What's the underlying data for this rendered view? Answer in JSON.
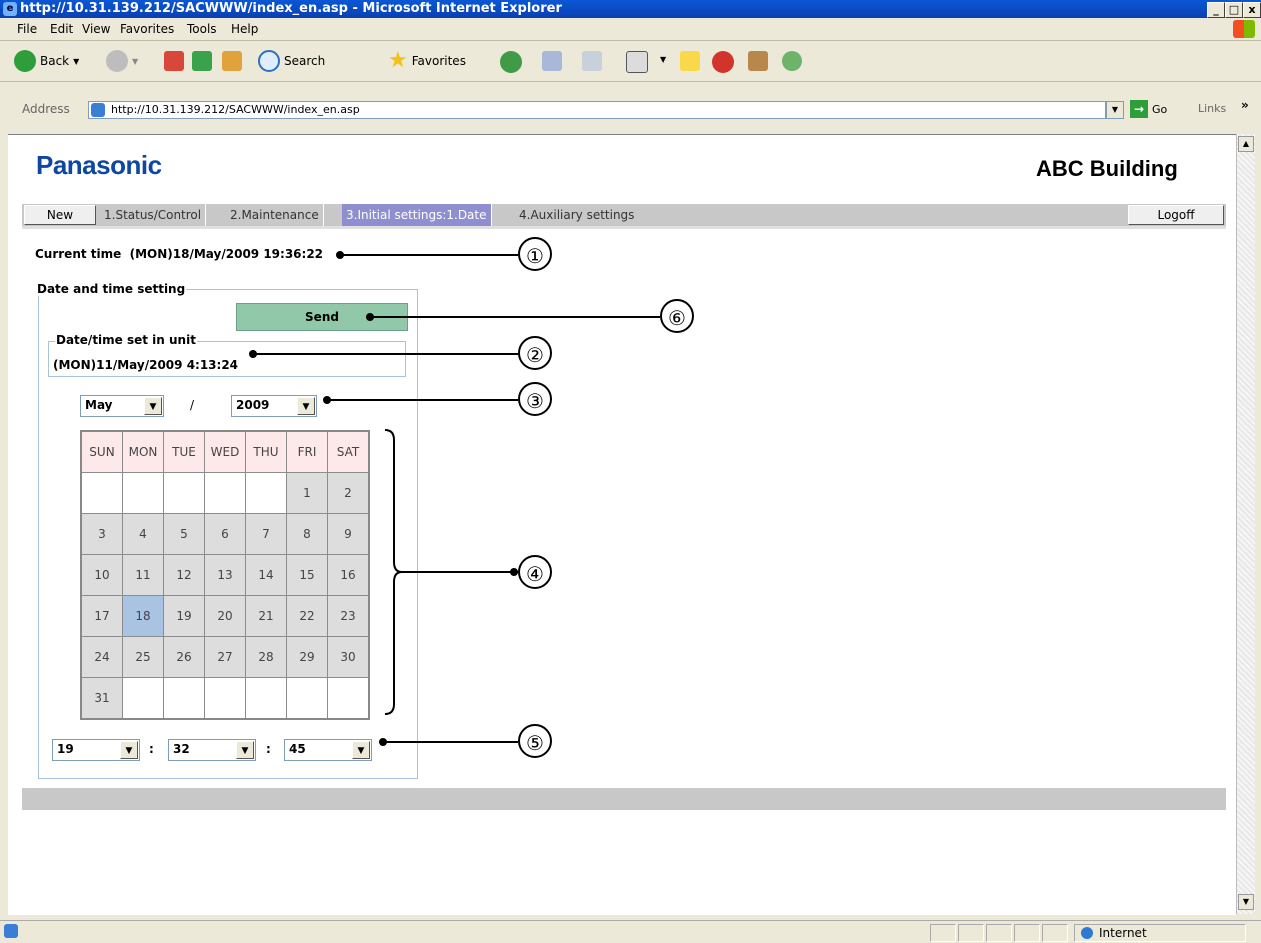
{
  "window": {
    "title": "http://10.31.139.212/SACWWW/index_en.asp - Microsoft Internet Explorer",
    "controls": [
      "_",
      "□",
      "x"
    ]
  },
  "menu": [
    "File",
    "Edit",
    "View",
    "Favorites",
    "Tools",
    "Help"
  ],
  "toolbar": {
    "back": "Back",
    "search": "Search",
    "favorites": "Favorites"
  },
  "address": {
    "label": "Address",
    "url": "http://10.31.139.212/SACWWW/index_en.asp",
    "go": "Go",
    "links": "Links"
  },
  "status": {
    "zone": "Internet"
  },
  "page": {
    "logo": "Panasonic",
    "building": "ABC Building",
    "nav": {
      "new": "New",
      "items": [
        "1.Status/Control",
        "2.Maintenance",
        "3.Initial settings:1.Date",
        "4.Auxiliary settings"
      ],
      "logoff": "Logoff"
    },
    "current_time": "Current time  (MON)18/May/2009 19:36:22",
    "date_setting_legend": "Date and time setting",
    "send_label": "Send",
    "unit_legend": "Date/time set in unit",
    "unit_value": "(MON)11/May/2009 4:13:24",
    "month": "May",
    "sep_slash": "/",
    "year": "2009",
    "calendar": {
      "headers": [
        "SUN",
        "MON",
        "TUE",
        "WED",
        "THU",
        "FRI",
        "SAT"
      ],
      "weeks": [
        [
          "",
          "",
          "",
          "",
          "",
          "1",
          "2"
        ],
        [
          "3",
          "4",
          "5",
          "6",
          "7",
          "8",
          "9"
        ],
        [
          "10",
          "11",
          "12",
          "13",
          "14",
          "15",
          "16"
        ],
        [
          "17",
          "18",
          "19",
          "20",
          "21",
          "22",
          "23"
        ],
        [
          "24",
          "25",
          "26",
          "27",
          "28",
          "29",
          "30"
        ],
        [
          "31",
          "",
          "",
          "",
          "",
          "",
          ""
        ]
      ],
      "selected_day": "18"
    },
    "hour": "19",
    "minute": "32",
    "second": "45",
    "time_sep": ":"
  },
  "callouts": [
    "①",
    "②",
    "③",
    "④",
    "⑤",
    "⑥"
  ]
}
